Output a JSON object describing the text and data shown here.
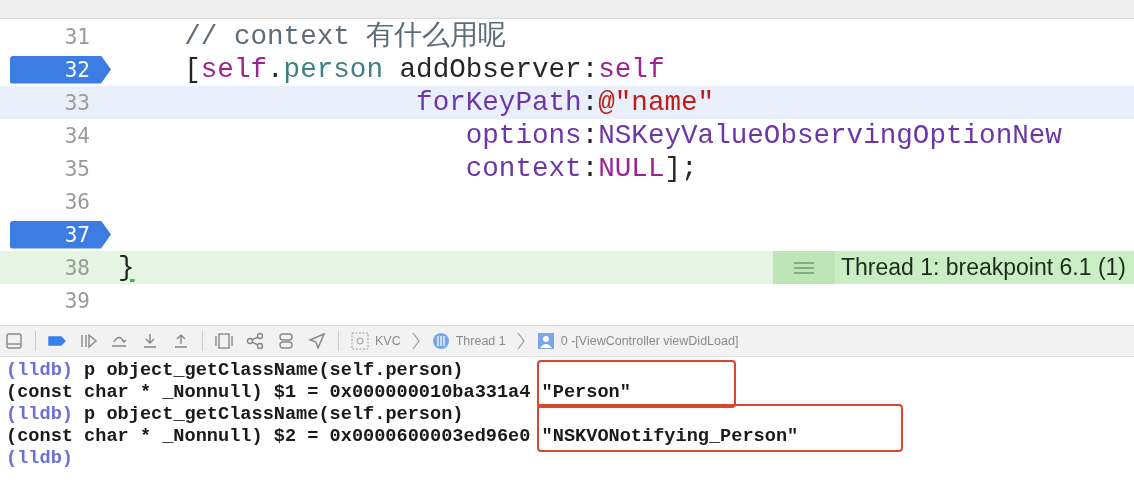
{
  "editor": {
    "lines": [
      {
        "number": "31",
        "breakpoint": false,
        "current": false,
        "stopped": false,
        "indented": true,
        "tokens": [
          {
            "text": "// context 有什么用呢",
            "kind": "comment"
          }
        ]
      },
      {
        "number": "32",
        "breakpoint": true,
        "current": false,
        "stopped": false,
        "indented": true,
        "tokens": [
          {
            "text": "[",
            "kind": "plain"
          },
          {
            "text": "self",
            "kind": "keyword"
          },
          {
            "text": ".",
            "kind": "plain"
          },
          {
            "text": "person",
            "kind": "property"
          },
          {
            "text": " addObserver:",
            "kind": "plain"
          },
          {
            "text": "self",
            "kind": "keyword"
          }
        ]
      },
      {
        "number": "33",
        "breakpoint": false,
        "current": true,
        "stopped": false,
        "continuation": true,
        "tokens": [
          {
            "text": "forKeyPath",
            "kind": "method"
          },
          {
            "text": ":",
            "kind": "plain"
          },
          {
            "text": "@\"name\"",
            "kind": "string"
          }
        ]
      },
      {
        "number": "34",
        "breakpoint": false,
        "current": false,
        "stopped": false,
        "continuation": true,
        "tokens": [
          {
            "text": "options",
            "kind": "method"
          },
          {
            "text": ":",
            "kind": "plain"
          },
          {
            "text": "NSKeyValueObservingOptionNew",
            "kind": "method"
          }
        ]
      },
      {
        "number": "35",
        "breakpoint": false,
        "current": false,
        "stopped": false,
        "continuation": true,
        "tokens": [
          {
            "text": "context",
            "kind": "method"
          },
          {
            "text": ":",
            "kind": "plain"
          },
          {
            "text": "NULL",
            "kind": "keyword"
          },
          {
            "text": "];",
            "kind": "plain"
          }
        ]
      },
      {
        "number": "36",
        "breakpoint": false,
        "current": false,
        "stopped": false
      },
      {
        "number": "37",
        "breakpoint": true,
        "current": false,
        "stopped": false
      },
      {
        "number": "38",
        "breakpoint": false,
        "current": false,
        "stopped": true,
        "tokens": [
          {
            "text": "}",
            "kind": "plain"
          }
        ],
        "badge": "Thread 1: breakpoint 6.1 (1)"
      },
      {
        "number": "39",
        "breakpoint": false,
        "current": false,
        "stopped": false
      }
    ]
  },
  "debug_bar": {
    "breakpoints_active": true,
    "path": [
      "KVC",
      "Thread 1",
      "0 -[ViewController viewDidLoad]"
    ]
  },
  "console": {
    "lines": [
      {
        "kind": "command",
        "prompt": "(lldb)",
        "text": " p object_getClassName(self.person)"
      },
      {
        "kind": "output",
        "text": "(const char * _Nonnull) $1 = 0x000000010ba331a4 ",
        "value": "\"Person\"",
        "boxed": true
      },
      {
        "kind": "command",
        "prompt": "(lldb)",
        "text": " p object_getClassName(self.person)"
      },
      {
        "kind": "output",
        "text": "(const char * _Nonnull) $2 = 0x0000600003ed96e0 ",
        "value": "\"NSKVONotifying_Person\"",
        "boxed": true
      },
      {
        "kind": "command",
        "prompt": "(lldb)"
      }
    ]
  }
}
